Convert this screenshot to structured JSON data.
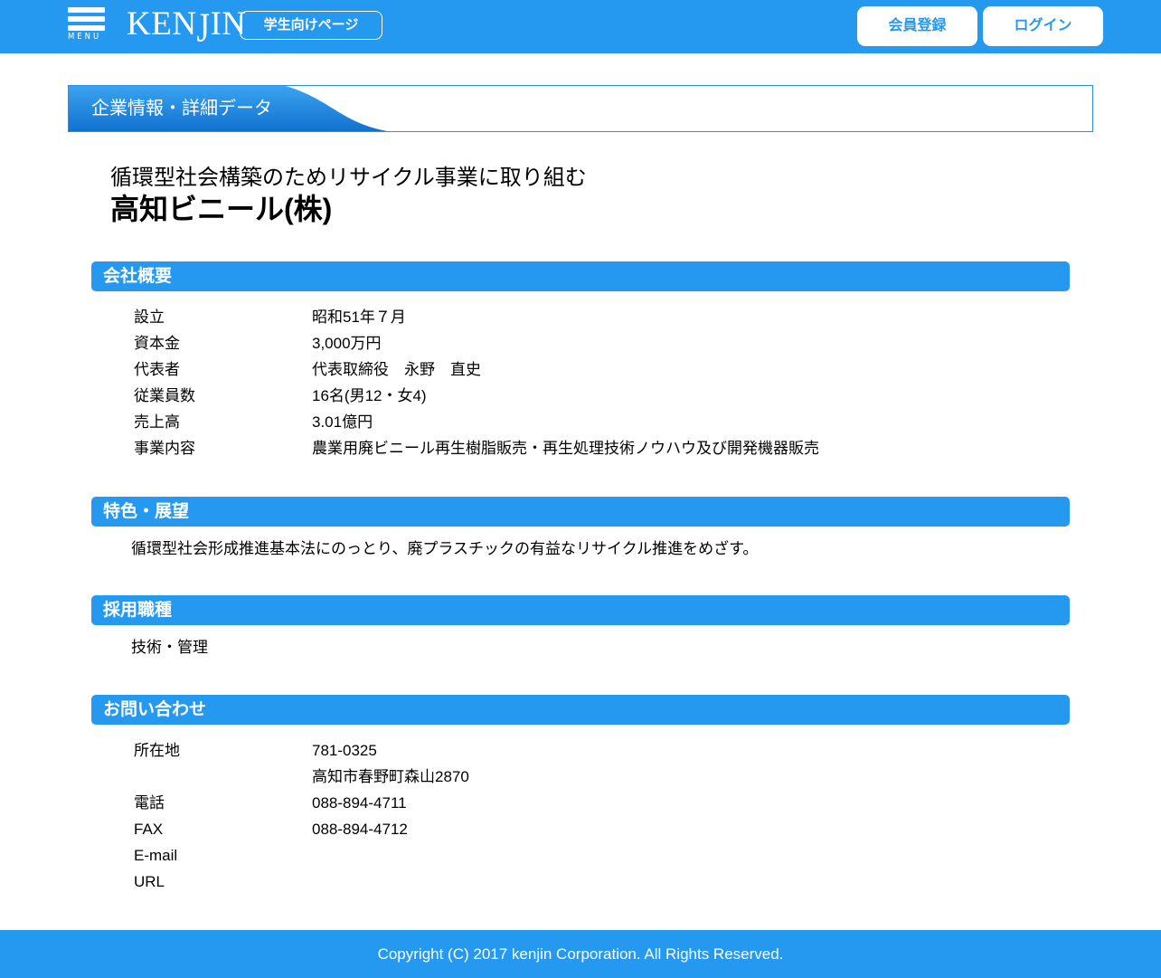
{
  "header": {
    "menu_label": "MENU",
    "logo_prefix": "KEN",
    "logo_j": "J",
    "logo_suffix": "IN",
    "student_page_label": "学生向けページ",
    "register_label": "会員登録",
    "login_label": "ログイン",
    "brand_color": "#2499ef"
  },
  "page_title": "企業情報・詳細データ",
  "company": {
    "catchphrase": "循環型社会構築のためリサイクル事業に取り組む",
    "name": "高知ビニール(株)"
  },
  "overview": {
    "heading": "会社概要",
    "rows": [
      {
        "label": "設立",
        "value": "昭和51年７月"
      },
      {
        "label": "資本金",
        "value": "3,000万円"
      },
      {
        "label": "代表者",
        "value": "代表取締役　永野　直史"
      },
      {
        "label": "従業員数",
        "value": "16名(男12・女4)"
      },
      {
        "label": "売上高",
        "value": "3.01億円"
      },
      {
        "label": "事業内容",
        "value": "農業用廃ビニール再生樹脂販売・再生処理技術ノウハウ及び開発機器販売"
      }
    ]
  },
  "features": {
    "heading": "特色・展望",
    "text": "循環型社会形成推進基本法にのっとり、廃プラスチックの有益なリサイクル推進をめざす。"
  },
  "jobs": {
    "heading": "採用職種",
    "text": "技術・管理"
  },
  "contact": {
    "heading": "お問い合わせ",
    "rows": [
      {
        "label": "所在地",
        "value": "781-0325"
      },
      {
        "label": "",
        "value": "高知市春野町森山2870"
      },
      {
        "label": "電話",
        "value": "088-894-4711"
      },
      {
        "label": "FAX",
        "value": "088-894-4712"
      },
      {
        "label": "E-mail",
        "value": ""
      },
      {
        "label": "URL",
        "value": ""
      }
    ]
  },
  "footer": {
    "copyright": "Copyright (C) 2017 kenjin Corporation. All Rights Reserved."
  }
}
